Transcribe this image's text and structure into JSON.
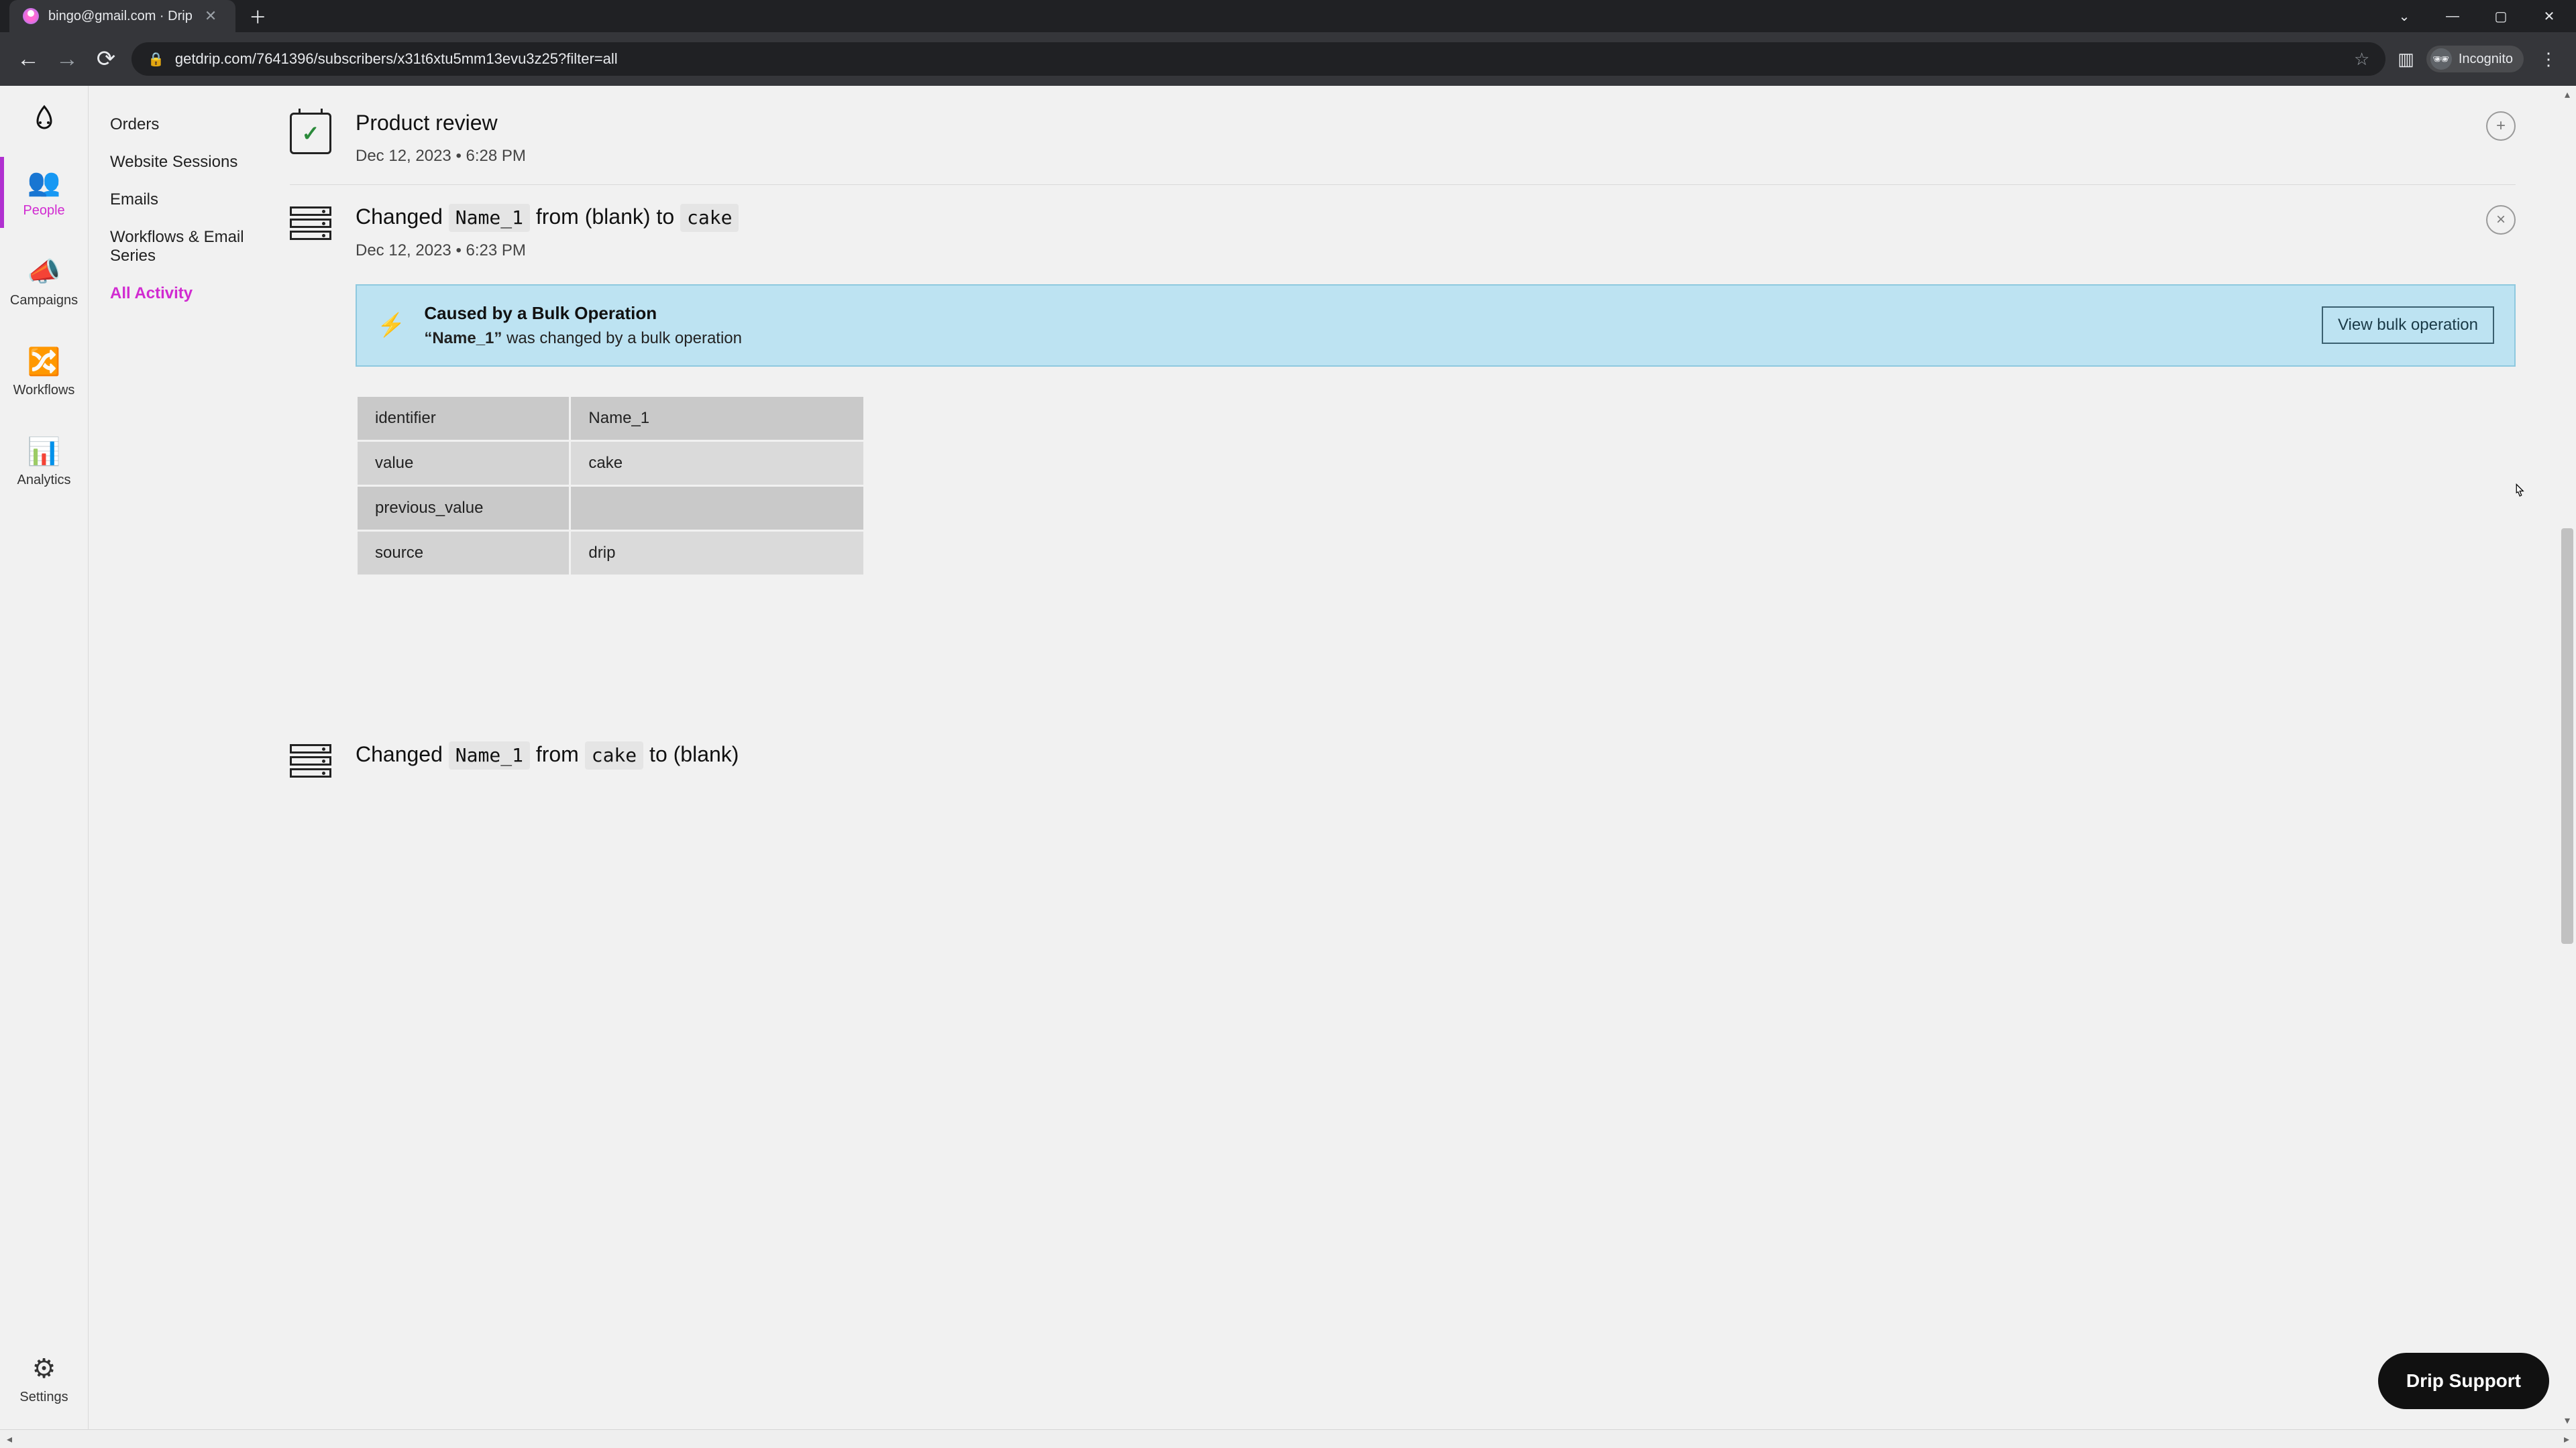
{
  "browser": {
    "tab_title": "bingo@gmail.com · Drip",
    "url_display": "getdrip.com/7641396/subscribers/x31t6xtu5mm13evu3z25?filter=all",
    "incognito_label": "Incognito"
  },
  "rail": {
    "items": [
      {
        "label": "People",
        "icon": "👥",
        "active": true
      },
      {
        "label": "Campaigns",
        "icon": "📣",
        "active": false
      },
      {
        "label": "Workflows",
        "icon": "🔀",
        "active": false
      },
      {
        "label": "Analytics",
        "icon": "📊",
        "active": false
      }
    ],
    "settings_label": "Settings"
  },
  "filters": {
    "items": [
      "Orders",
      "Website Sessions",
      "Emails",
      "Workflows & Email Series",
      "All Activity"
    ],
    "active": "All Activity"
  },
  "activity": {
    "item0": {
      "title": "Product review",
      "timestamp": "Dec 12, 2023 • 6:28 PM"
    },
    "item1": {
      "title_prefix": "Changed ",
      "title_chip": "Name_1",
      "title_mid": " from (blank) to ",
      "title_chip2": "cake",
      "timestamp": "Dec 12, 2023 • 6:23 PM",
      "bulk": {
        "heading": "Caused by a Bulk Operation",
        "quoted": "“Name_1”",
        "rest": " was changed by a bulk operation",
        "button": "View bulk operation"
      },
      "details": [
        {
          "k": "identifier",
          "v": "Name_1"
        },
        {
          "k": "value",
          "v": "cake"
        },
        {
          "k": "previous_value",
          "v": ""
        },
        {
          "k": "source",
          "v": "drip"
        }
      ]
    },
    "item2": {
      "title_prefix": "Changed ",
      "title_chip": "Name_1",
      "title_mid": " from ",
      "title_chip2": "cake",
      "title_suffix": " to (blank)"
    }
  },
  "fab": {
    "label": "Drip Support"
  }
}
